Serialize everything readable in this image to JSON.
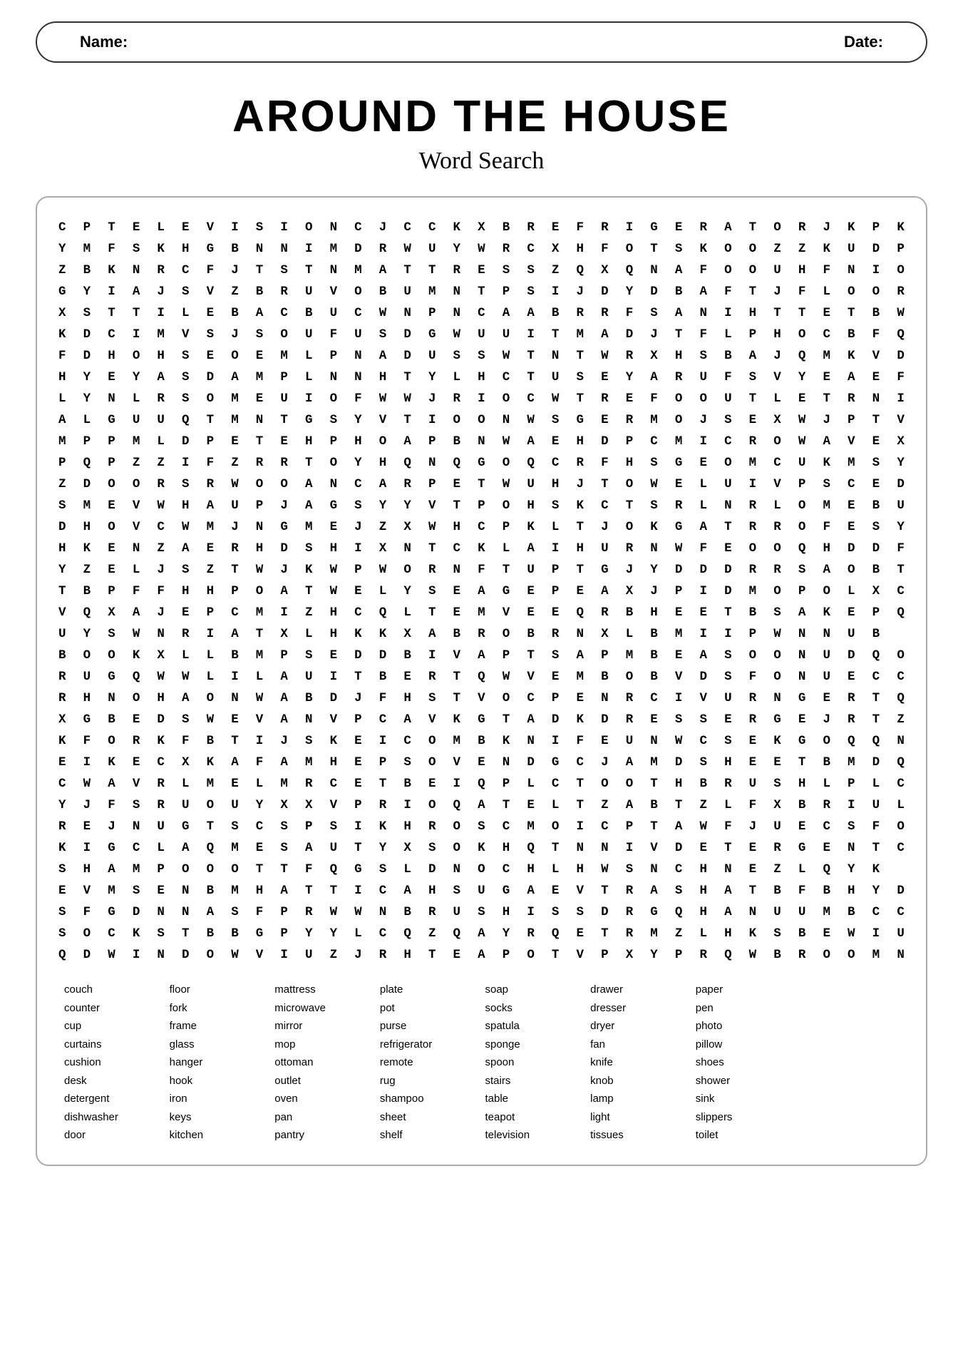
{
  "header": {
    "name_label": "Name:",
    "date_label": "Date:"
  },
  "title": "Around The House",
  "subtitle": "Word Search",
  "grid": [
    "CPTELEVISIONCJCCKXBREFRIGERATORJKPK",
    "YMFSKHGBNNIMDRWUYWRCXHFOTSKOOЗZKUDP",
    "ZBKNRCFJTSNMATTRESSZQXQNAFOOUНFNIО",
    "GYIAJSVZBRU VOBUMNTPSIJDYDBAFJFLOOR",
    "XSTTILE BACBUCWNPNCAAБRRFSANIHТTETBW",
    "KDCIMVSJSOUFUSDGWUUITMАDJТFLPHOCBFQ",
    "FDHOHSEOEMLPNADUSSWTNTWRXHSBAJQMKVD",
    "HYEYASDAMPLNNHTYLN CTUSEУАRUFSVУEAEF",
    "LYNLRSOMEUIOFWWJRIOCWTREFOOUTLETRNI",
    "ALGUUQTMNTGSYVTIOONWSGERMOJSEXWJPTV",
    "MPPМLDPETEHPHOАРBNWAEHD PCMICROWAVEX",
    "PQPZZIFZRRTOYНQNQGOQCRFHSGEOMCUKMSY",
    "ZDOORSRWOOANCАРETWUHJTOWELUIVPSCED",
    "SMEVWHAUPJAGSYYVTPOHSKCTSR LNRLOMEBU",
    "DHOVCWMJNGMEJZXWHCPKLTJOKGAТRROFESY",
    "HKENZAERHDSHIXNTCKLAIНURNWFEOОQHDDF",
    "YZELJ SZTWJKWPWORNFTUPTGJYDDDRRSAOBTC",
    "TBPFFHHPOATWELУSEAGEPEAXJPIDMOPOLXC",
    "VQXAJEPCMIZHCQLTEMVEEQRBHEETBSAKEPQ",
    "UYSWNRIATXLHKKXABROBRNXLBMIIPWNNUB",
    "BOOKXLLBMPSEDDBIVAPTSA PMBEASOONUDQO",
    "RUGQWWLILAUITBERTQWVEMBOBVDSFONUECC",
    "RНNOHAONWABDJFHSTVOCPENRCIUURNGERTQ",
    "XGBEDSWEVANVPCAVKGTADKDRESSERGEJRTZ",
    "KFORKFBTIJSKEICOMBKNIFEUНWCSEKGOQQN",
    "EIKECXKAFAMHEPSOVEND GCJAMDSHEETBMDQ",
    "CWAVRLMELMRCETBEIQPLCTOOTHBRUSHLPLC",
    "YJFSRUOUYXXVPRIOQATELТZABТZLFXBRIul",
    "REJNUGTSCSPSIKHROSCMOICPTAWFJUECSFO",
    "KIGCLAQMESAUTYX SOKHQTNNI VDETERGENTCC",
    "SHAMPOOOTTFQGSLDNOHLHWSNCHNE ZLQYK",
    "EVMSENBMHATTICAHSUGAEVTRASHATBFBHYD",
    "SFGDNNASF PRWWNBRUSHISSDRGQHANUUMBCC",
    "SOCKSTBBGPYYLCQZQAYRQETRMZLHKSBEWIU",
    "QDWINDOWVIUZJRHTEAPOTVPXУPRQWBROOMN"
  ],
  "grid_rows": [
    [
      "C",
      "P",
      "T",
      "E",
      "L",
      "E",
      "V",
      "I",
      "S",
      "I",
      "O",
      "N",
      "C",
      "J",
      "C",
      "C",
      "K",
      "X",
      "B",
      "R",
      "E",
      "F",
      "R",
      "I",
      "G",
      "E",
      "R",
      "A",
      "T",
      "O",
      "R",
      "J",
      "K",
      "P",
      "K"
    ],
    [
      "Y",
      "M",
      "F",
      "S",
      "K",
      "H",
      "G",
      "B",
      "N",
      "N",
      "I",
      "M",
      "D",
      "R",
      "W",
      "U",
      "Y",
      "W",
      "R",
      "C",
      "X",
      "H",
      "F",
      "O",
      "T",
      "S",
      "K",
      "O",
      "O",
      "Z",
      "Z",
      "K",
      "U",
      "D",
      "P"
    ],
    [
      "Z",
      "B",
      "K",
      "N",
      "R",
      "C",
      "F",
      "J",
      "T",
      "S",
      "T",
      "N",
      "M",
      "A",
      "T",
      "T",
      "R",
      "E",
      "S",
      "S",
      "Z",
      "Q",
      "X",
      "Q",
      "N",
      "A",
      "F",
      "O",
      "O",
      "U",
      "H",
      "F",
      "N",
      "I",
      "O"
    ],
    [
      "G",
      "Y",
      "I",
      "A",
      "J",
      "S",
      "V",
      "Z",
      "B",
      "R",
      "U",
      "V",
      "O",
      "B",
      "U",
      "M",
      "N",
      "T",
      "P",
      "S",
      "I",
      "J",
      "D",
      "Y",
      "D",
      "B",
      "A",
      "F",
      "T",
      "J",
      "F",
      "L",
      "O",
      "O",
      "R"
    ],
    [
      "X",
      "S",
      "T",
      "T",
      "I",
      "L",
      "E",
      "B",
      "A",
      "C",
      "B",
      "U",
      "C",
      "W",
      "N",
      "P",
      "N",
      "C",
      "A",
      "A",
      "B",
      "R",
      "R",
      "F",
      "S",
      "A",
      "N",
      "I",
      "H",
      "T",
      "T",
      "E",
      "T",
      "B",
      "W"
    ],
    [
      "K",
      "D",
      "C",
      "I",
      "M",
      "V",
      "S",
      "J",
      "S",
      "O",
      "U",
      "F",
      "U",
      "S",
      "D",
      "G",
      "W",
      "U",
      "U",
      "I",
      "T",
      "M",
      "A",
      "D",
      "J",
      "T",
      "F",
      "L",
      "P",
      "H",
      "O",
      "C",
      "B",
      "F",
      "Q"
    ],
    [
      "F",
      "D",
      "H",
      "O",
      "H",
      "S",
      "E",
      "O",
      "E",
      "M",
      "L",
      "P",
      "N",
      "A",
      "D",
      "U",
      "S",
      "S",
      "W",
      "T",
      "N",
      "T",
      "W",
      "R",
      "X",
      "H",
      "S",
      "B",
      "A",
      "J",
      "Q",
      "M",
      "K",
      "V",
      "D"
    ],
    [
      "H",
      "Y",
      "E",
      "Y",
      "A",
      "S",
      "D",
      "A",
      "M",
      "P",
      "L",
      "N",
      "N",
      "H",
      "T",
      "Y",
      "L",
      "H",
      "C",
      "T",
      "U",
      "S",
      "E",
      "Y",
      "A",
      "R",
      "U",
      "F",
      "S",
      "V",
      "Y",
      "E",
      "A",
      "E",
      "F"
    ],
    [
      "L",
      "Y",
      "N",
      "L",
      "R",
      "S",
      "O",
      "M",
      "E",
      "U",
      "I",
      "O",
      "F",
      "W",
      "W",
      "J",
      "R",
      "I",
      "O",
      "C",
      "W",
      "T",
      "R",
      "E",
      "F",
      "O",
      "O",
      "U",
      "T",
      "L",
      "E",
      "T",
      "R",
      "N",
      "I"
    ],
    [
      "A",
      "L",
      "G",
      "U",
      "U",
      "Q",
      "T",
      "M",
      "N",
      "T",
      "G",
      "S",
      "Y",
      "V",
      "T",
      "I",
      "O",
      "O",
      "N",
      "W",
      "S",
      "G",
      "E",
      "R",
      "M",
      "O",
      "J",
      "S",
      "E",
      "X",
      "W",
      "J",
      "P",
      "T",
      "V"
    ],
    [
      "M",
      "P",
      "P",
      "M",
      "L",
      "D",
      "P",
      "E",
      "T",
      "E",
      "H",
      "P",
      "H",
      "O",
      "A",
      "P",
      "B",
      "N",
      "W",
      "A",
      "E",
      "H",
      "D",
      "P",
      "C",
      "M",
      "I",
      "C",
      "R",
      "O",
      "W",
      "A",
      "V",
      "E",
      "X"
    ],
    [
      "P",
      "Q",
      "P",
      "Z",
      "Z",
      "I",
      "F",
      "Z",
      "R",
      "R",
      "T",
      "O",
      "Y",
      "H",
      "Q",
      "N",
      "Q",
      "G",
      "O",
      "Q",
      "C",
      "R",
      "F",
      "H",
      "S",
      "G",
      "E",
      "O",
      "M",
      "C",
      "U",
      "K",
      "M",
      "S",
      "Y"
    ],
    [
      "Z",
      "D",
      "O",
      "O",
      "R",
      "S",
      "R",
      "W",
      "O",
      "O",
      "A",
      "N",
      "C",
      "A",
      "R",
      "P",
      "E",
      "T",
      "W",
      "U",
      "H",
      "J",
      "T",
      "O",
      "W",
      "E",
      "L",
      "U",
      "I",
      "V",
      "P",
      "S",
      "C",
      "E",
      "D"
    ],
    [
      "S",
      "M",
      "E",
      "V",
      "W",
      "H",
      "A",
      "U",
      "P",
      "J",
      "A",
      "G",
      "S",
      "Y",
      "Y",
      "V",
      "T",
      "P",
      "O",
      "H",
      "S",
      "K",
      "C",
      "T",
      "S",
      "R",
      "L",
      "N",
      "R",
      "L",
      "O",
      "M",
      "E",
      "B",
      "U"
    ],
    [
      "D",
      "H",
      "O",
      "V",
      "C",
      "W",
      "M",
      "J",
      "N",
      "G",
      "M",
      "E",
      "J",
      "Z",
      "X",
      "W",
      "H",
      "C",
      "P",
      "K",
      "L",
      "T",
      "J",
      "O",
      "K",
      "G",
      "A",
      "T",
      "R",
      "R",
      "O",
      "F",
      "E",
      "S",
      "Y"
    ],
    [
      "H",
      "K",
      "E",
      "N",
      "Z",
      "A",
      "E",
      "R",
      "H",
      "D",
      "S",
      "H",
      "I",
      "X",
      "N",
      "T",
      "C",
      "K",
      "L",
      "A",
      "I",
      "H",
      "U",
      "R",
      "N",
      "W",
      "F",
      "E",
      "O",
      "O",
      "Q",
      "H",
      "D",
      "D",
      "F"
    ],
    [
      "Y",
      "Z",
      "E",
      "L",
      "J",
      "S",
      "Z",
      "T",
      "W",
      "J",
      "K",
      "W",
      "P",
      "W",
      "O",
      "R",
      "N",
      "F",
      "T",
      "U",
      "P",
      "T",
      "G",
      "J",
      "Y",
      "D",
      "D",
      "D",
      "R",
      "R",
      "S",
      "A",
      "O",
      "B",
      "T"
    ],
    [
      "T",
      "B",
      "P",
      "F",
      "F",
      "H",
      "H",
      "P",
      "O",
      "A",
      "T",
      "W",
      "E",
      "L",
      "Y",
      "S",
      "E",
      "A",
      "G",
      "E",
      "P",
      "E",
      "A",
      "X",
      "J",
      "P",
      "I",
      "D",
      "M",
      "O",
      "P",
      "O",
      "L",
      "X",
      "C"
    ],
    [
      "V",
      "Q",
      "X",
      "A",
      "J",
      "E",
      "P",
      "C",
      "M",
      "I",
      "Z",
      "H",
      "C",
      "Q",
      "L",
      "T",
      "E",
      "M",
      "V",
      "E",
      "E",
      "Q",
      "R",
      "B",
      "H",
      "E",
      "E",
      "T",
      "B",
      "S",
      "A",
      "K",
      "E",
      "P",
      "Q"
    ],
    [
      "U",
      "Y",
      "S",
      "W",
      "N",
      "R",
      "I",
      "A",
      "T",
      "X",
      "L",
      "H",
      "K",
      "K",
      "X",
      "A",
      "B",
      "R",
      "O",
      "B",
      "R",
      "N",
      "X",
      "L",
      "B",
      "M",
      "I",
      "I",
      "P",
      "W",
      "N",
      "N",
      "U",
      "B",
      ""
    ],
    [
      "B",
      "O",
      "O",
      "K",
      "X",
      "L",
      "L",
      "B",
      "M",
      "P",
      "S",
      "E",
      "D",
      "D",
      "B",
      "I",
      "V",
      "A",
      "P",
      "T",
      "S",
      "A",
      "P",
      "M",
      "B",
      "E",
      "A",
      "S",
      "O",
      "O",
      "N",
      "U",
      "D",
      "Q",
      "O"
    ],
    [
      "R",
      "U",
      "G",
      "Q",
      "W",
      "W",
      "L",
      "I",
      "L",
      "A",
      "U",
      "I",
      "T",
      "B",
      "E",
      "R",
      "T",
      "Q",
      "W",
      "V",
      "E",
      "M",
      "B",
      "O",
      "B",
      "V",
      "D",
      "S",
      "F",
      "O",
      "N",
      "U",
      "E",
      "C",
      "C"
    ],
    [
      "R",
      "H",
      "N",
      "O",
      "H",
      "A",
      "O",
      "N",
      "W",
      "A",
      "B",
      "D",
      "J",
      "F",
      "H",
      "S",
      "T",
      "V",
      "O",
      "C",
      "P",
      "E",
      "N",
      "R",
      "C",
      "I",
      "V",
      "U",
      "R",
      "N",
      "G",
      "E",
      "R",
      "T",
      "Q"
    ],
    [
      "X",
      "G",
      "B",
      "E",
      "D",
      "S",
      "W",
      "E",
      "V",
      "A",
      "N",
      "V",
      "P",
      "C",
      "A",
      "V",
      "K",
      "G",
      "T",
      "A",
      "D",
      "K",
      "D",
      "R",
      "E",
      "S",
      "S",
      "E",
      "R",
      "G",
      "E",
      "J",
      "R",
      "T",
      "Z"
    ],
    [
      "K",
      "F",
      "O",
      "R",
      "K",
      "F",
      "B",
      "T",
      "I",
      "J",
      "S",
      "K",
      "E",
      "I",
      "C",
      "O",
      "M",
      "B",
      "K",
      "N",
      "I",
      "F",
      "E",
      "U",
      "N",
      "W",
      "C",
      "S",
      "E",
      "K",
      "G",
      "O",
      "Q",
      "Q",
      "N"
    ],
    [
      "E",
      "I",
      "K",
      "E",
      "C",
      "X",
      "K",
      "A",
      "F",
      "A",
      "M",
      "H",
      "E",
      "P",
      "S",
      "O",
      "V",
      "E",
      "N",
      "D",
      "G",
      "C",
      "J",
      "A",
      "M",
      "D",
      "S",
      "H",
      "E",
      "E",
      "T",
      "B",
      "M",
      "D",
      "Q"
    ],
    [
      "C",
      "W",
      "A",
      "V",
      "R",
      "L",
      "M",
      "E",
      "L",
      "M",
      "R",
      "C",
      "E",
      "T",
      "B",
      "E",
      "I",
      "Q",
      "P",
      "L",
      "C",
      "T",
      "O",
      "O",
      "T",
      "H",
      "B",
      "R",
      "U",
      "S",
      "H",
      "L",
      "P",
      "L",
      "C"
    ],
    [
      "Y",
      "J",
      "F",
      "S",
      "R",
      "U",
      "O",
      "U",
      "Y",
      "X",
      "X",
      "V",
      "P",
      "R",
      "I",
      "O",
      "Q",
      "A",
      "T",
      "E",
      "L",
      "T",
      "Z",
      "A",
      "B",
      "T",
      "Z",
      "L",
      "F",
      "X",
      "B",
      "R",
      "I",
      "U",
      "L"
    ],
    [
      "R",
      "E",
      "J",
      "N",
      "U",
      "G",
      "T",
      "S",
      "C",
      "S",
      "P",
      "S",
      "I",
      "K",
      "H",
      "R",
      "O",
      "S",
      "C",
      "M",
      "O",
      "I",
      "C",
      "P",
      "T",
      "A",
      "W",
      "F",
      "J",
      "U",
      "E",
      "C",
      "S",
      "F",
      "O"
    ],
    [
      "K",
      "I",
      "G",
      "C",
      "L",
      "A",
      "Q",
      "M",
      "E",
      "S",
      "A",
      "U",
      "T",
      "Y",
      "X",
      "S",
      "O",
      "K",
      "H",
      "Q",
      "T",
      "N",
      "N",
      "I",
      "V",
      "D",
      "E",
      "T",
      "E",
      "R",
      "G",
      "E",
      "N",
      "T",
      "C"
    ],
    [
      "S",
      "H",
      "A",
      "M",
      "P",
      "O",
      "O",
      "O",
      "T",
      "T",
      "F",
      "Q",
      "G",
      "S",
      "L",
      "D",
      "N",
      "O",
      "C",
      "H",
      "L",
      "H",
      "W",
      "S",
      "N",
      "C",
      "H",
      "N",
      "E",
      "Z",
      "L",
      "Q",
      "Y",
      "K",
      ""
    ],
    [
      "E",
      "V",
      "M",
      "S",
      "E",
      "N",
      "B",
      "M",
      "H",
      "A",
      "T",
      "T",
      "I",
      "C",
      "A",
      "H",
      "S",
      "U",
      "G",
      "A",
      "E",
      "V",
      "T",
      "R",
      "A",
      "S",
      "H",
      "A",
      "T",
      "B",
      "F",
      "B",
      "H",
      "Y",
      "D"
    ],
    [
      "S",
      "F",
      "G",
      "D",
      "N",
      "N",
      "A",
      "S",
      "F",
      "P",
      "R",
      "W",
      "W",
      "N",
      "B",
      "R",
      "U",
      "S",
      "H",
      "I",
      "S",
      "S",
      "D",
      "R",
      "G",
      "Q",
      "H",
      "A",
      "N",
      "U",
      "U",
      "M",
      "B",
      "C",
      "C"
    ],
    [
      "S",
      "O",
      "C",
      "K",
      "S",
      "T",
      "B",
      "B",
      "G",
      "P",
      "Y",
      "Y",
      "L",
      "C",
      "Q",
      "Z",
      "Q",
      "A",
      "Y",
      "R",
      "Q",
      "E",
      "T",
      "R",
      "M",
      "Z",
      "L",
      "H",
      "K",
      "S",
      "B",
      "E",
      "W",
      "I",
      "U"
    ],
    [
      "Q",
      "D",
      "W",
      "I",
      "N",
      "D",
      "O",
      "W",
      "V",
      "I",
      "U",
      "Z",
      "J",
      "R",
      "H",
      "T",
      "E",
      "A",
      "P",
      "O",
      "T",
      "V",
      "P",
      "X",
      "Y",
      "P",
      "R",
      "Q",
      "W",
      "B",
      "R",
      "O",
      "O",
      "M",
      "N"
    ]
  ],
  "word_columns": [
    {
      "words": [
        "couch",
        "counter",
        "cup",
        "curtains",
        "cushion",
        "desk",
        "detergent",
        "dishwasher",
        "door"
      ]
    },
    {
      "words": [
        "floor",
        "fork",
        "frame",
        "glass",
        "hanger",
        "hook",
        "iron",
        "keys",
        "kitchen"
      ]
    },
    {
      "words": [
        "mattress",
        "microwave",
        "mirror",
        "mop",
        "ottoman",
        "outlet",
        "oven",
        "pan",
        "pantry"
      ]
    },
    {
      "words": [
        "plate",
        "pot",
        "purse",
        "refrigerator",
        "remote",
        "rug",
        "shampoo",
        "sheet",
        "shelf"
      ]
    },
    {
      "words": [
        "soap",
        "socks",
        "spatula",
        "sponge",
        "spoon",
        "stairs",
        "table",
        "teapot",
        "television"
      ]
    },
    {
      "words": [
        "drawer",
        "dresser",
        "dryer",
        "fan",
        "knife",
        "knob",
        "lamp",
        "light",
        "tissues"
      ]
    },
    {
      "words": [
        "paper",
        "pen",
        "photo",
        "pillow",
        "shoes",
        "shower",
        "sink",
        "slippers",
        "toilet"
      ]
    }
  ]
}
